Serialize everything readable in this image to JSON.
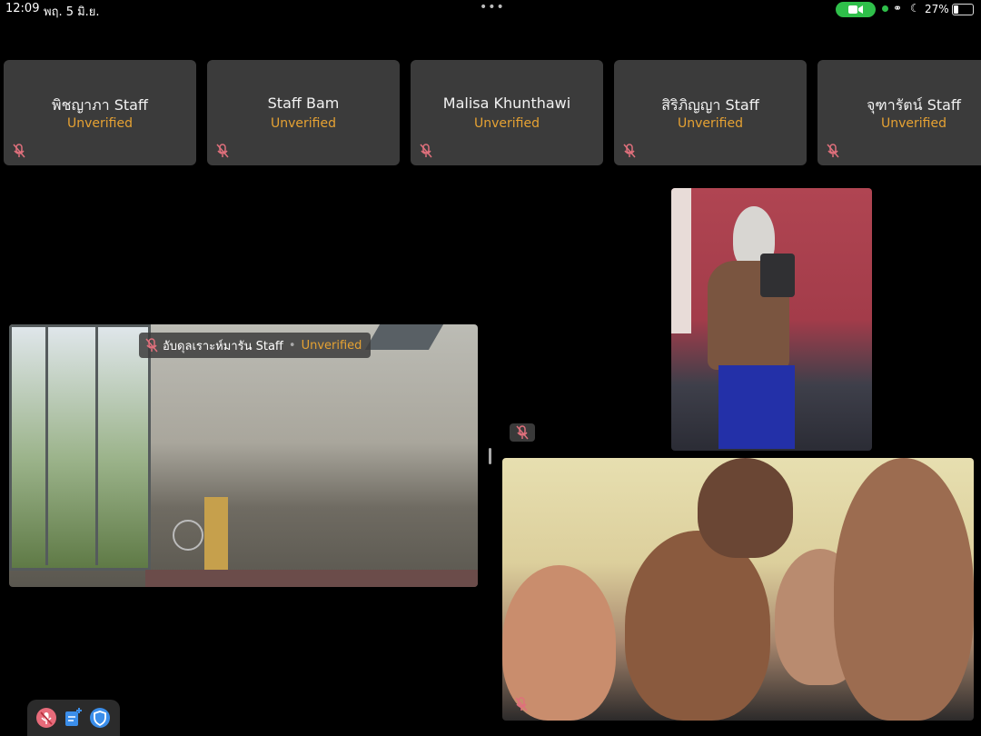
{
  "status_bar": {
    "time": "12:09",
    "date": "พฤ. 5 มิ.ย.",
    "multitask_dots": "•••",
    "battery_percent": "27%",
    "battery_level": 0.27,
    "camera_indicator_color": "#2fbf4a"
  },
  "participants": [
    {
      "name": "พิชญาภา Staff",
      "status": "Unverified",
      "muted": true
    },
    {
      "name": "Staff Bam",
      "status": "Unverified",
      "muted": true
    },
    {
      "name": "Malisa Khunthawi",
      "status": "Unverified",
      "muted": true
    },
    {
      "name": "สิริภิญญา Staff",
      "status": "Unverified",
      "muted": true
    },
    {
      "name": "จุฑารัตน์ Staff",
      "status": "Unverified",
      "muted": true
    }
  ],
  "active_video": {
    "name": "อับดุลเราะห์มารัน Staff",
    "status": "Unverified"
  },
  "colors": {
    "accent_status": "#e6a233",
    "tile_bg": "#3b3b3b",
    "muted_icon": "#e0707c",
    "toolbar_mute": "#e76b7a",
    "toolbar_icon_blue": "#3b8eea"
  },
  "toolbar": {
    "icons": [
      "mic-muted-icon",
      "edit-note-icon",
      "shield-icon"
    ]
  }
}
